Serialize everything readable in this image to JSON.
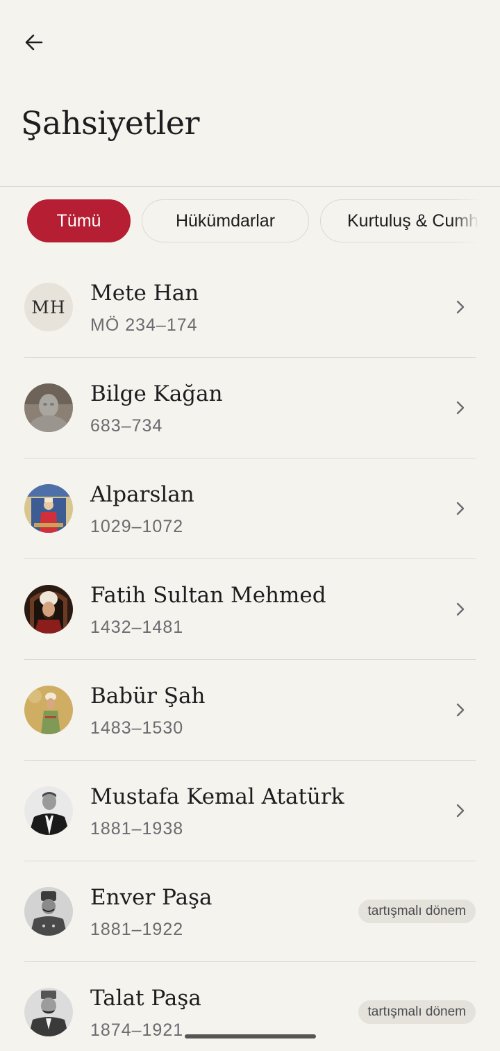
{
  "header": {
    "title": "Şahsiyetler"
  },
  "filters": [
    {
      "label": "Tümü",
      "active": true
    },
    {
      "label": "Hükümdarlar",
      "active": false
    },
    {
      "label": "Kurtuluş & Cumhuriyet",
      "active": false
    }
  ],
  "people": [
    {
      "name": "Mete Han",
      "years": "MÖ 234–174",
      "avatar_initials": "MH",
      "avatar_type": "initials",
      "badge": null
    },
    {
      "name": "Bilge Kağan",
      "years": "683–734",
      "avatar_type": "photo",
      "badge": null
    },
    {
      "name": "Alparslan",
      "years": "1029–1072",
      "avatar_type": "photo",
      "badge": null
    },
    {
      "name": "Fatih Sultan Mehmed",
      "years": "1432–1481",
      "avatar_type": "photo",
      "badge": null
    },
    {
      "name": "Babür Şah",
      "years": "1483–1530",
      "avatar_type": "photo",
      "badge": null
    },
    {
      "name": "Mustafa Kemal Atatürk",
      "years": "1881–1938",
      "avatar_type": "photo",
      "badge": null
    },
    {
      "name": "Enver Paşa",
      "years": "1881–1922",
      "avatar_type": "photo",
      "badge": "tartışmalı dönem"
    },
    {
      "name": "Talat Paşa",
      "years": "1874–1921",
      "avatar_type": "photo",
      "badge": "tartışmalı dönem"
    }
  ],
  "colors": {
    "accent": "#b51e33",
    "background": "#f5f3ee"
  },
  "icons": {
    "back": "arrow-left-icon",
    "row_action": "chevron-right-icon"
  }
}
